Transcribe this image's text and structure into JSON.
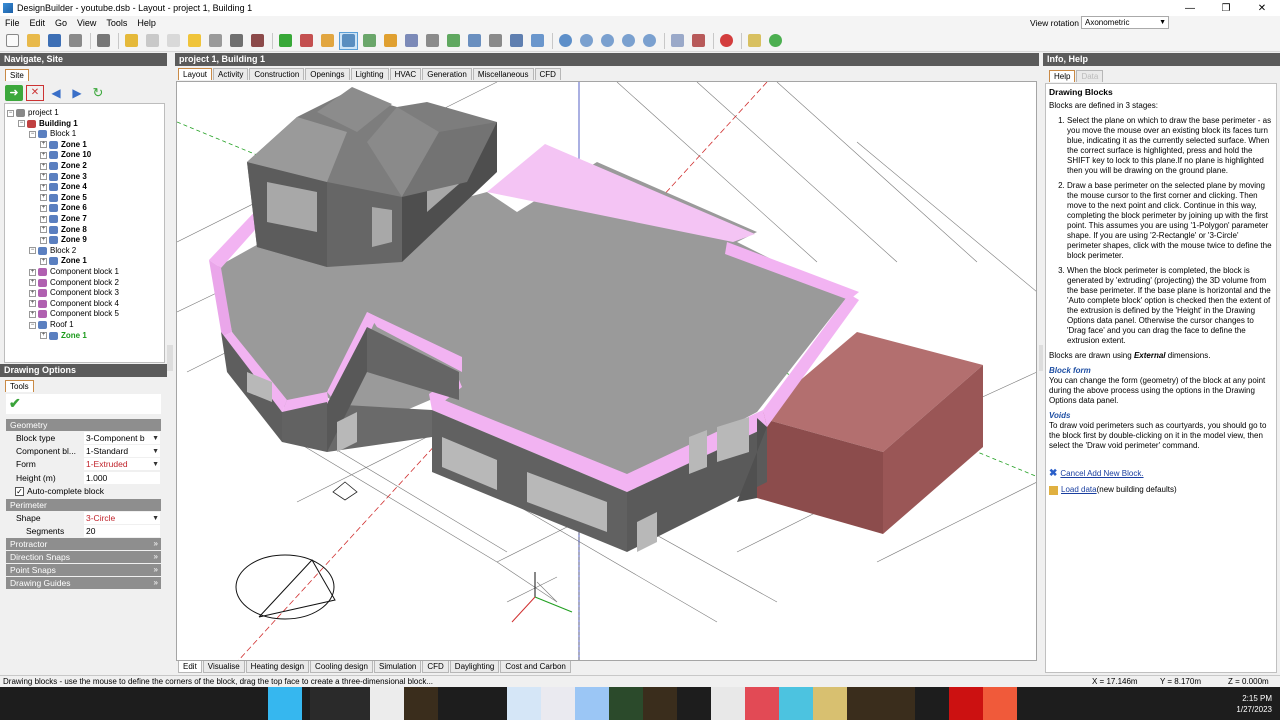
{
  "window": {
    "title": "DesignBuilder - youtube.dsb - Layout - project 1, Building 1"
  },
  "menu": [
    "File",
    "Edit",
    "Go",
    "View",
    "Tools",
    "Help"
  ],
  "view_rotation": {
    "label": "View rotation",
    "value": "Axonometric"
  },
  "nav": {
    "header": "Navigate, Site",
    "tab": "Site",
    "tree": [
      {
        "label": "project 1",
        "indent": 0,
        "bold": false
      },
      {
        "label": "Building 1",
        "indent": 1,
        "bold": true
      },
      {
        "label": "Block 1",
        "indent": 2,
        "bold": false
      },
      {
        "label": "Zone 1",
        "indent": 3,
        "bold": true
      },
      {
        "label": "Zone 10",
        "indent": 3,
        "bold": true
      },
      {
        "label": "Zone 2",
        "indent": 3,
        "bold": true
      },
      {
        "label": "Zone 3",
        "indent": 3,
        "bold": true
      },
      {
        "label": "Zone 4",
        "indent": 3,
        "bold": true
      },
      {
        "label": "Zone 5",
        "indent": 3,
        "bold": true
      },
      {
        "label": "Zone 6",
        "indent": 3,
        "bold": true
      },
      {
        "label": "Zone 7",
        "indent": 3,
        "bold": true
      },
      {
        "label": "Zone 8",
        "indent": 3,
        "bold": true
      },
      {
        "label": "Zone 9",
        "indent": 3,
        "bold": true
      },
      {
        "label": "Block 2",
        "indent": 2,
        "bold": false
      },
      {
        "label": "Zone 1",
        "indent": 3,
        "bold": true
      },
      {
        "label": "Component block 1",
        "indent": 2,
        "bold": false
      },
      {
        "label": "Component block 2",
        "indent": 2,
        "bold": false
      },
      {
        "label": "Component block 3",
        "indent": 2,
        "bold": false
      },
      {
        "label": "Component block 4",
        "indent": 2,
        "bold": false
      },
      {
        "label": "Component block 5",
        "indent": 2,
        "bold": false
      },
      {
        "label": "Roof 1",
        "indent": 2,
        "bold": false
      },
      {
        "label": "Zone 1",
        "indent": 3,
        "bold": true,
        "green": true
      }
    ]
  },
  "drawing_options": {
    "header": "Drawing Options",
    "tab": "Tools",
    "geometry_label": "Geometry",
    "block_type": {
      "label": "Block type",
      "value": "3-Component b"
    },
    "component_block": {
      "label": "Component bl...",
      "value": "1-Standard"
    },
    "form": {
      "label": "Form",
      "value": "1-Extruded"
    },
    "height": {
      "label": "Height (m)",
      "value": "1.000"
    },
    "auto_complete": {
      "label": "Auto-complete block",
      "checked": true
    },
    "perimeter_label": "Perimeter",
    "shape": {
      "label": "Shape",
      "value": "3-Circle"
    },
    "segments": {
      "label": "Segments",
      "value": "20"
    },
    "protractor": "Protractor",
    "direction_snaps": "Direction Snaps",
    "point_snaps": "Point Snaps",
    "drawing_guides": "Drawing Guides"
  },
  "viewport": {
    "header": "project 1, Building 1",
    "tabs": [
      "Layout",
      "Activity",
      "Construction",
      "Openings",
      "Lighting",
      "HVAC",
      "Generation",
      "Miscellaneous",
      "CFD"
    ],
    "bottom_tabs": [
      "Edit",
      "Visualise",
      "Heating design",
      "Cooling design",
      "Simulation",
      "CFD",
      "Daylighting",
      "Cost and Carbon"
    ]
  },
  "info": {
    "header": "Info, Help",
    "tabs": [
      "Help",
      "Data"
    ],
    "title": "Drawing Blocks",
    "intro": "Blocks are defined in 3 stages:",
    "steps": [
      "Select the plane on which to draw the base perimeter - as you move the mouse over an existing block its faces turn blue, indicating it as the currently selected surface. When the correct surface is highlighted, press and hold the SHIFT key to lock to this plane.If no plane is highlighted then you will be drawing on the ground plane.",
      "Draw a base perimeter on the selected plane by moving the mouse cursor to the first corner and clicking. Then move to the next point and click. Continue in this way, completing the block perimeter by joining up with the first point. This assumes you are using '1-Polygon' parameter shape. If you are using '2-Rectangle' or '3-Circle' perimeter shapes, click with the mouse twice to define the block perimeter.",
      "When the block perimeter is completed, the block is generated by 'extruding' (projecting) the 3D volume from the base perimeter. If the base plane is horizontal and the 'Auto complete block' option is checked then the extent of the extrusion is defined by the 'Height' in the Drawing Options data panel. Otherwise the cursor changes to 'Drag face' and you can drag the face to define the extrusion extent."
    ],
    "external_pre": "Blocks are drawn using ",
    "external_em": "External",
    "external_post": " dimensions.",
    "block_form_title": "Block form",
    "block_form_text": "You can change the form (geometry) of the block at any point during the above process using the options in the Drawing Options data panel.",
    "voids_title": "Voids",
    "voids_text": "To draw void perimeters such as courtyards, you should go to the block first by double-clicking on it in the model view, then select the 'Draw void perimeter' command.",
    "cancel_link": "Cancel Add New Block.",
    "load_link": "Load data",
    "load_suffix": " (new building defaults)"
  },
  "status": {
    "message": "Drawing blocks - use the mouse to define the corners of the block, drag the top face to create a three-dimensional block...",
    "x": "X = 17.146m",
    "y": "Y = 8.170m",
    "z": "Z = 0.000m"
  },
  "clock": {
    "time": "2:15 PM",
    "date": "1/27/2023"
  },
  "colors": {
    "panel_header": "#5b5b5b",
    "section": "#8e8e8e",
    "pink": "#f4b6f4",
    "brown": "#8d4c4c",
    "link": "#1a3fa0"
  }
}
